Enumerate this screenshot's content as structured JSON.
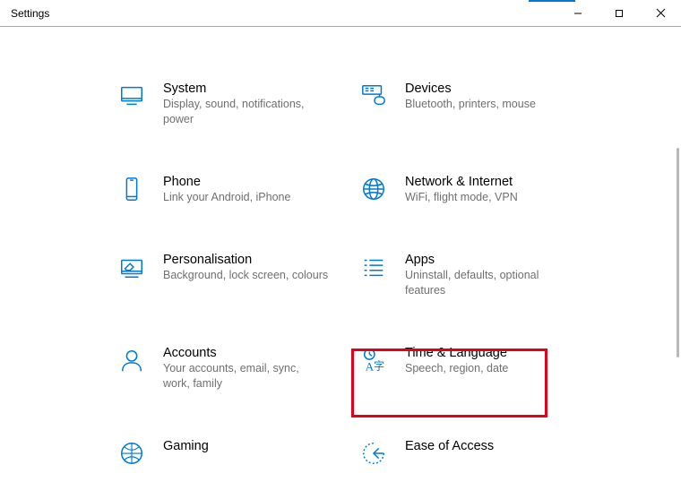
{
  "window": {
    "title": "Settings"
  },
  "tiles": {
    "system": {
      "title": "System",
      "desc": "Display, sound, notifications, power"
    },
    "devices": {
      "title": "Devices",
      "desc": "Bluetooth, printers, mouse"
    },
    "phone": {
      "title": "Phone",
      "desc": "Link your Android, iPhone"
    },
    "network": {
      "title": "Network & Internet",
      "desc": "WiFi, flight mode, VPN"
    },
    "personalisation": {
      "title": "Personalisation",
      "desc": "Background, lock screen, colours"
    },
    "apps": {
      "title": "Apps",
      "desc": "Uninstall, defaults, optional features"
    },
    "accounts": {
      "title": "Accounts",
      "desc": "Your accounts, email, sync, work, family"
    },
    "time": {
      "title": "Time & Language",
      "desc": "Speech, region, date"
    },
    "gaming": {
      "title": "Gaming",
      "desc": ""
    },
    "ease": {
      "title": "Ease of Access",
      "desc": ""
    }
  }
}
